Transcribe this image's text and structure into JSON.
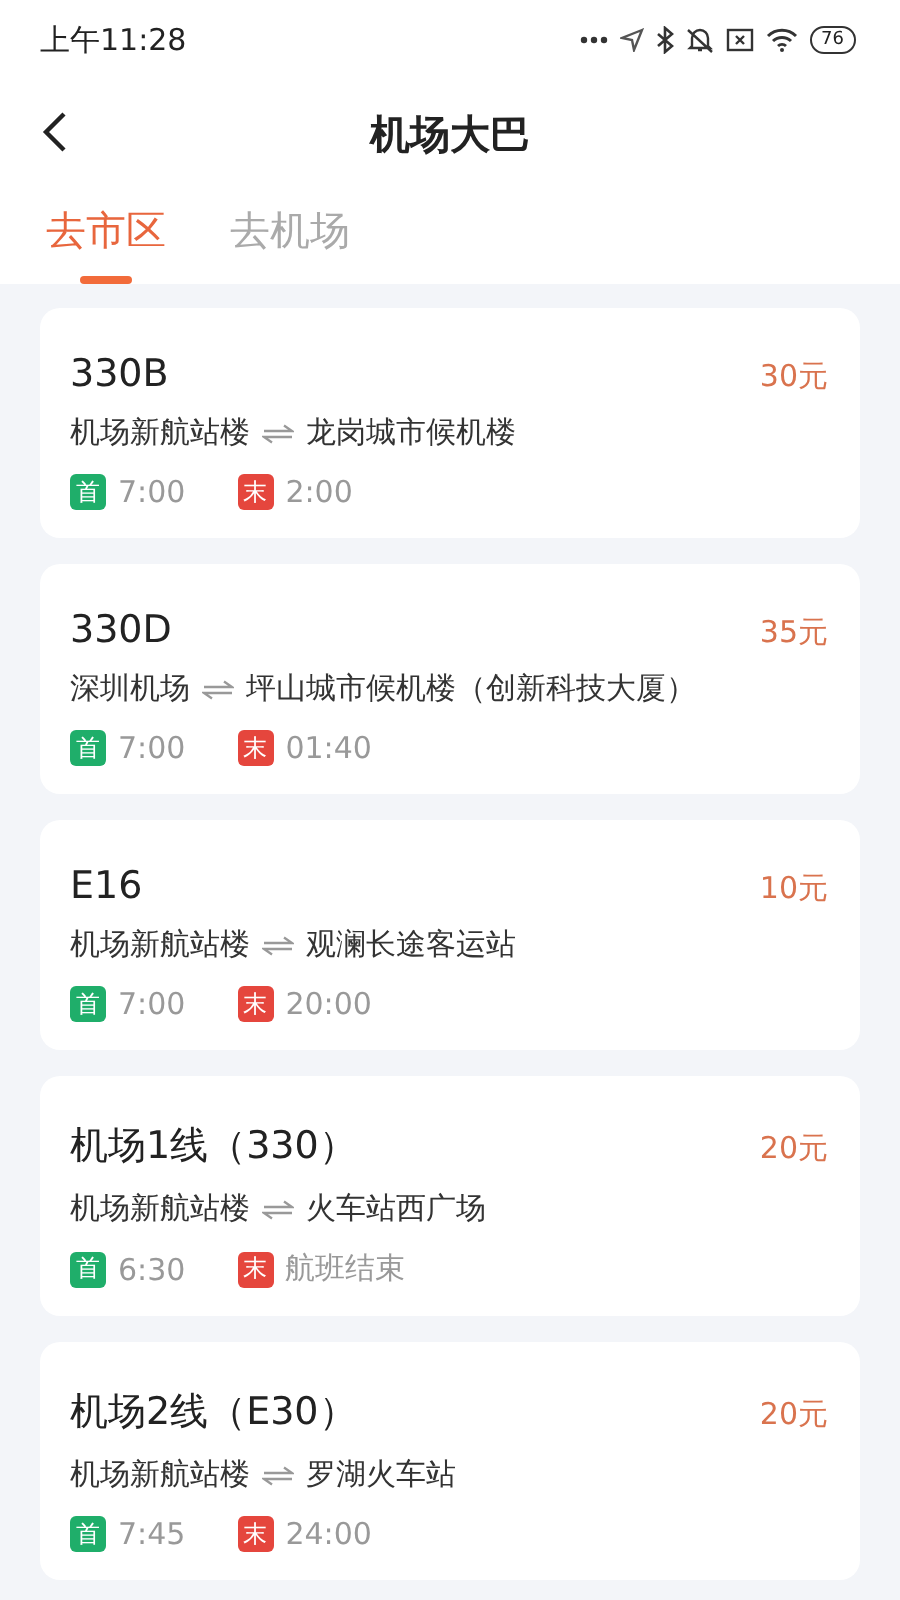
{
  "status_bar": {
    "time": "上午11:28",
    "battery": "76"
  },
  "header": {
    "title": "机场大巴"
  },
  "tabs": [
    {
      "label": "去市区",
      "selected": true
    },
    {
      "label": "去机场",
      "selected": false
    }
  ],
  "routes": [
    {
      "name": "330B",
      "price": "30元",
      "from": "机场新航站楼",
      "to": "龙岗城市候机楼",
      "first_label": "首",
      "first": "7:00",
      "last_label": "末",
      "last": "2:00"
    },
    {
      "name": "330D",
      "price": "35元",
      "from": "深圳机场",
      "to": "坪山城市候机楼（创新科技大厦）",
      "first_label": "首",
      "first": "7:00",
      "last_label": "末",
      "last": "01:40"
    },
    {
      "name": "E16",
      "price": "10元",
      "from": "机场新航站楼",
      "to": "观澜长途客运站",
      "first_label": "首",
      "first": "7:00",
      "last_label": "末",
      "last": "20:00"
    },
    {
      "name": "机场1线（330）",
      "price": "20元",
      "from": "机场新航站楼",
      "to": "火车站西广场",
      "first_label": "首",
      "first": "6:30",
      "last_label": "末",
      "last": "航班结束"
    },
    {
      "name": "机场2线（E30）",
      "price": "20元",
      "from": "机场新航站楼",
      "to": "罗湖火车站",
      "first_label": "首",
      "first": "7:45",
      "last_label": "末",
      "last": "24:00"
    }
  ]
}
